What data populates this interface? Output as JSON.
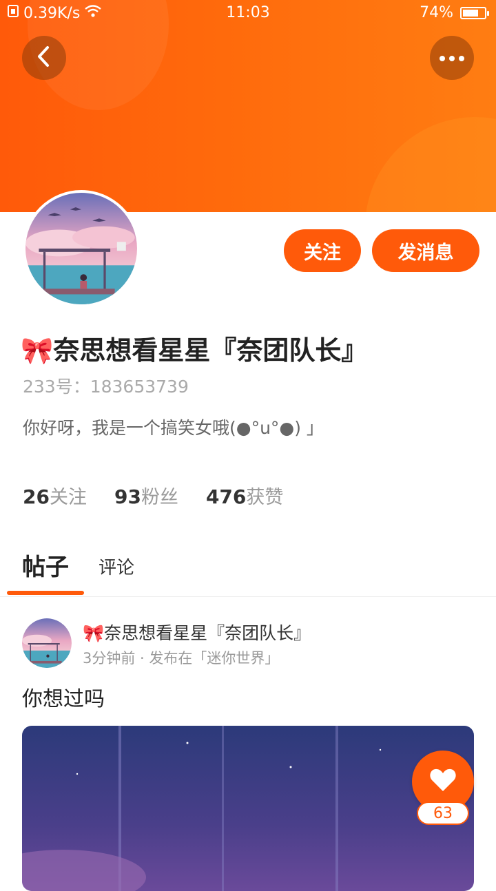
{
  "status_bar": {
    "network_speed": "0.39K/s",
    "time": "11:03",
    "battery_percent": "74%",
    "battery_level": 0.74,
    "icons": [
      "sim-icon",
      "wifi-icon",
      "battery-icon"
    ]
  },
  "header": {
    "icons": {
      "back": "chevron-left-icon",
      "more": "more-dots-icon"
    }
  },
  "profile": {
    "name": "🎀奈思想看星星『奈团队长』",
    "uid": "233号：183653739",
    "bio": "你好呀，我是一个搞笑女哦(●°u°●) 」",
    "follow_label": "关注",
    "message_label": "发消息",
    "stats": [
      {
        "value": "26",
        "label": "关注"
      },
      {
        "value": "93",
        "label": "粉丝"
      },
      {
        "value": "476",
        "label": "获赞"
      }
    ]
  },
  "tabs": [
    {
      "label": "帖子",
      "active": true
    },
    {
      "label": "评论",
      "active": false
    }
  ],
  "post": {
    "author": "🎀奈思想看星星『奈团队长』",
    "meta": "3分钟前 · 发布在「迷你世界」",
    "text": "你想过吗",
    "like_count": "63"
  },
  "colors": {
    "accent": "#ff5a0a",
    "banner_start": "#ff5a0a",
    "banner_end": "#ff7d12"
  }
}
